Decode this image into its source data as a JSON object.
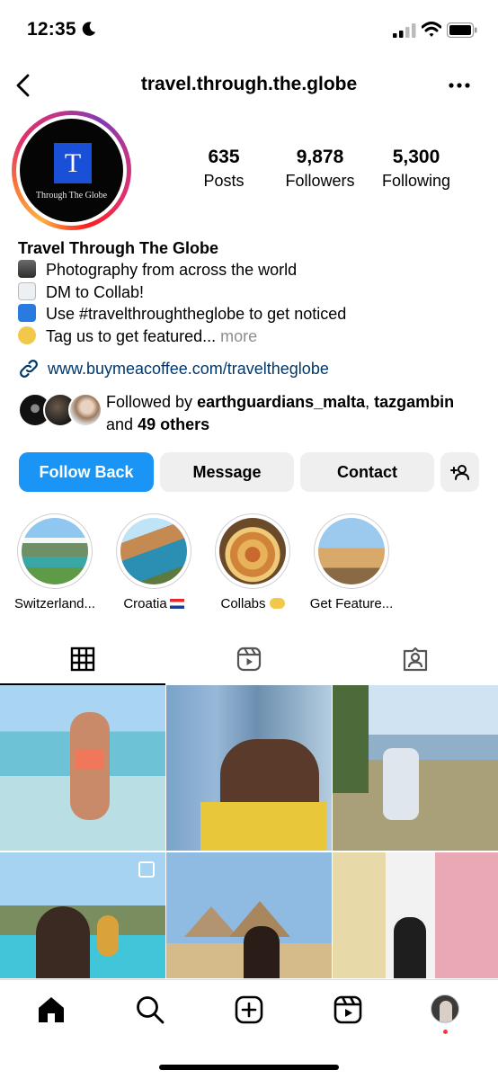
{
  "status_bar": {
    "time": "12:35"
  },
  "header": {
    "username": "travel.through.the.globe"
  },
  "profile": {
    "avatar_letter": "T",
    "avatar_text": "Through The Globe",
    "stats": [
      {
        "value": "635",
        "label": "Posts"
      },
      {
        "value": "9,878",
        "label": "Followers"
      },
      {
        "value": "5,300",
        "label": "Following"
      }
    ]
  },
  "bio": {
    "name": "Travel Through The Globe",
    "lines": [
      {
        "icon": "camera-flash-emoji",
        "text": "Photography from across the world"
      },
      {
        "icon": "envelope-emoji",
        "text": "DM to Collab!"
      },
      {
        "icon": "right-arrow-emoji",
        "text": "Use #travelthroughtheglobe to get noticed"
      },
      {
        "icon": "folded-hands-emoji",
        "text": "Tag us to get featured..."
      }
    ],
    "more": "more",
    "link": "www.buymeacoffee.com/traveltheglobe"
  },
  "followed_by": {
    "prefix": "Followed by",
    "user1": "earthguardians_malta",
    "separator": ",",
    "user2": "tazgambin",
    "and": "and",
    "others": "49 others"
  },
  "buttons": {
    "follow_back": "Follow Back",
    "message": "Message",
    "contact": "Contact"
  },
  "highlights": [
    {
      "label": "Switzerland..."
    },
    {
      "label": "Croatia"
    },
    {
      "label": "Collabs"
    },
    {
      "label": "Get Feature..."
    }
  ],
  "colors": {
    "primary_button": "#1b95f5",
    "link": "#00376b",
    "secondary_button": "#efefef"
  }
}
